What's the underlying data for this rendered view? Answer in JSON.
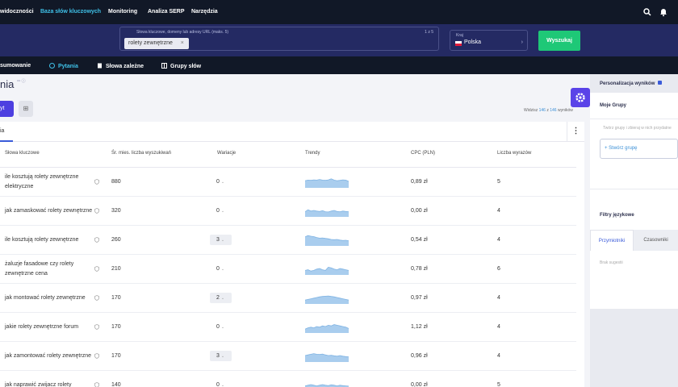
{
  "topnav": {
    "items": [
      "widoczności",
      "Baza słów kluczowych",
      "Monitoring",
      "Analiza SERP",
      "Narzędzia"
    ],
    "active_index": 1,
    "icons": [
      "search-icon",
      "bell-icon"
    ]
  },
  "search": {
    "keyword_label": "Słowa kluczowe, domeny lub adresy URL (maks. 5)",
    "counter": "1 z 5",
    "keyword_tag": "rolety zewnętrzne",
    "tag_remove": "×",
    "country_label": "Kraj",
    "country_value": "Polska",
    "country_chevron": "›",
    "search_button": "Wyszukaj"
  },
  "subnav": {
    "items": [
      "sumowanie",
      "Pytania",
      "Słowa zależne",
      "Grupy słów"
    ],
    "active_index": 1
  },
  "page": {
    "title": "nia",
    "title_badge": "⁹⁹ ⓘ",
    "primary_button": "yt",
    "secondary_button": "⊞",
    "visible_prefix": "Widzisz",
    "visible_shown": "146",
    "visible_of": "z",
    "visible_total": "146",
    "visible_suffix": "wyników"
  },
  "table": {
    "active_tab": "ia",
    "menu": "⋮",
    "columns": [
      "Słowa kluczowe",
      "Śr. mies. liczba wyszukiwań",
      "Wariacje",
      "Trendy",
      "CPC (PLN)",
      "Liczba wyrazów"
    ],
    "rows": [
      {
        "keyword": "ile kosztują rolety zewnętrzne elektryczne",
        "volume": "880",
        "variations": "0",
        "cpc": "0,89 zł",
        "words": "5",
        "trend": [
          0.55,
          0.6,
          0.58,
          0.62,
          0.6,
          0.65,
          0.6,
          0.58,
          0.62,
          0.7,
          0.6,
          0.55,
          0.58,
          0.62,
          0.6,
          0.5
        ]
      },
      {
        "keyword": "jak zamaskować rolety zewnętrzne",
        "volume": "320",
        "variations": "0",
        "cpc": "0,00 zł",
        "words": "4",
        "trend": [
          0.4,
          0.55,
          0.45,
          0.5,
          0.45,
          0.42,
          0.48,
          0.4,
          0.38,
          0.45,
          0.5,
          0.42,
          0.4,
          0.45,
          0.42,
          0.4
        ]
      },
      {
        "keyword": "ile kosztują rolety zewnętrzne",
        "volume": "260",
        "variations": "3",
        "cpc": "0,54 zł",
        "words": "4",
        "trend": [
          0.7,
          0.8,
          0.75,
          0.72,
          0.65,
          0.6,
          0.62,
          0.58,
          0.55,
          0.5,
          0.48,
          0.5,
          0.45,
          0.42,
          0.44,
          0.4
        ]
      },
      {
        "keyword": "żaluzje fasadowe czy rolety zewnętrzne cena",
        "volume": "210",
        "variations": "0",
        "cpc": "0,78 zł",
        "words": "6",
        "trend": [
          0.35,
          0.4,
          0.3,
          0.35,
          0.45,
          0.5,
          0.4,
          0.35,
          0.6,
          0.55,
          0.45,
          0.4,
          0.5,
          0.45,
          0.4,
          0.35
        ]
      },
      {
        "keyword": "jak montować rolety zewnętrzne",
        "volume": "170",
        "variations": "2",
        "cpc": "0,97 zł",
        "words": "4",
        "trend": [
          0.3,
          0.35,
          0.4,
          0.45,
          0.5,
          0.55,
          0.58,
          0.6,
          0.62,
          0.58,
          0.55,
          0.5,
          0.45,
          0.4,
          0.35,
          0.3
        ]
      },
      {
        "keyword": "jakie rolety zewnętrzne forum",
        "volume": "170",
        "variations": "0",
        "cpc": "1,12 zł",
        "words": "4",
        "trend": [
          0.3,
          0.4,
          0.45,
          0.4,
          0.5,
          0.45,
          0.55,
          0.5,
          0.6,
          0.55,
          0.65,
          0.6,
          0.55,
          0.5,
          0.45,
          0.35
        ]
      },
      {
        "keyword": "jak zamontować rolety zewnętrzne",
        "volume": "170",
        "variations": "3",
        "cpc": "0,96 zł",
        "words": "4",
        "trend": [
          0.5,
          0.55,
          0.6,
          0.65,
          0.6,
          0.58,
          0.62,
          0.55,
          0.5,
          0.52,
          0.48,
          0.45,
          0.5,
          0.45,
          0.42,
          0.4
        ]
      },
      {
        "keyword": "jak naprawić zwijacz rolety",
        "volume": "140",
        "variations": "0",
        "cpc": "0,00 zł",
        "words": "5",
        "trend": [
          0.4,
          0.45,
          0.5,
          0.45,
          0.4,
          0.45,
          0.5,
          0.45,
          0.42,
          0.48,
          0.45,
          0.4,
          0.45,
          0.42,
          0.4,
          0.38
        ]
      }
    ],
    "variation_chevron": "⌄"
  },
  "right_panel": {
    "title": "Personalizacja wyników",
    "groups_title": "Moje Grupy",
    "groups_hint": "Twórz grupy i zbieraj w nich przydatne",
    "new_group": "+ Stwórz grupę",
    "lang_title": "Filtry językowe",
    "tabs": [
      "Przymiotniki",
      "Czasowniki"
    ],
    "empty": "Brak sugestii"
  },
  "colors": {
    "nav_bg": "#111827",
    "search_bg": "#242a63",
    "accent_cyan": "#3fc1e8",
    "search_button": "#1ec877",
    "gear_button": "#5a43e8",
    "trend_fill": "#a9cdee"
  }
}
